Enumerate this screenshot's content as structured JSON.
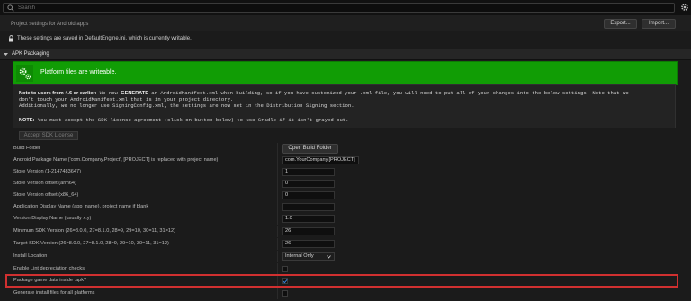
{
  "search": {
    "placeholder": "Search"
  },
  "header": {
    "title": "Project settings for Android apps",
    "export_label": "Export...",
    "import_label": "Import...",
    "info_text": "These settings are saved in DefaultEngine.ini, which is currently writable."
  },
  "section": {
    "title": "APK Packaging",
    "banner_text": "Platform files are writeable.",
    "note1_title": "Note to users from 4.6 or earlier:",
    "note1_a": " We now ",
    "note1_generate": "GENERATE",
    "note1_b": " an AndroidManifest.xml when building, so if you have customized your .xml file, you will need to put all of your changes into the below settings. Note that we",
    "note2": "don't touch your AndroidManifest.xml that is in your project directory.",
    "note3": "Additionally, we no longer use SigningConfig.xml, the settings are now set in the Distribution Signing section.",
    "note4_title": "NOTE:",
    "note4": " You must accept the SDK license agreement (click on button below) to use Gradle if it isn't grayed out.",
    "accept_label": "Accept SDK License"
  },
  "settings": [
    {
      "label": "Build Folder",
      "value": "Open Build Folder"
    },
    {
      "label": "Android Package Name ('com.Company.Project', [PROJECT] is replaced with project name)",
      "value": "com.YourCompany.[PROJECT]"
    },
    {
      "label": "Store Version (1-2147483647)",
      "value": "1"
    },
    {
      "label": "Store Version offset (arm64)",
      "value": "0"
    },
    {
      "label": "Store Version offset (x86_64)",
      "value": "0"
    },
    {
      "label": "Application Display Name (app_name), project name if blank",
      "value": ""
    },
    {
      "label": "Version Display Name (usually x.y)",
      "value": "1.0"
    },
    {
      "label": "Minimum SDK Version (26=8.0.0, 27=8.1.0, 28=9, 29=10, 30=11, 31=12)",
      "value": "26"
    },
    {
      "label": "Target SDK Version (26=8.0.0, 27=8.1.0, 28=9, 29=10, 30=11, 31=12)",
      "value": "26"
    },
    {
      "label": "Install Location",
      "value": "Internal Only"
    },
    {
      "label": "Enable Lint depreciation checks",
      "checked": false
    },
    {
      "label": "Package game data inside .apk?",
      "checked": true
    },
    {
      "label": "Generate install files for all platforms",
      "checked": false
    }
  ],
  "colors": {
    "banner": "#119d05",
    "highlight": "#d03030",
    "accent": "#3b82d6"
  }
}
